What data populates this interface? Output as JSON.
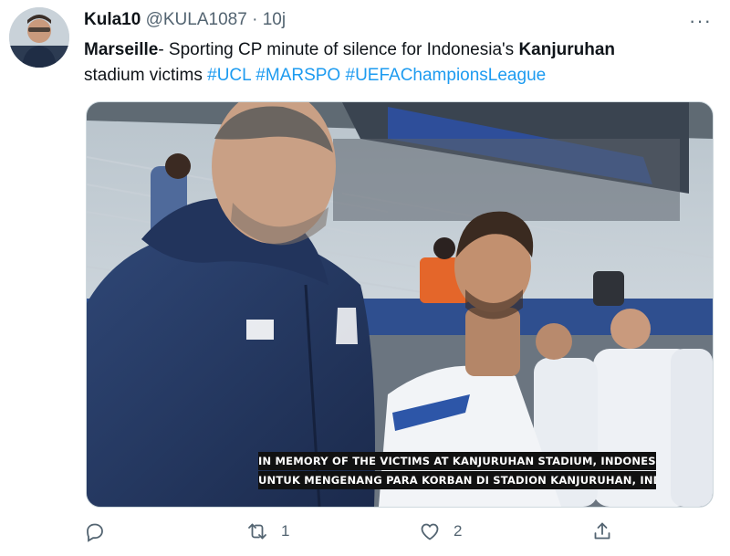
{
  "tweet": {
    "author_name": "Kula10",
    "author_handle": "@KULA1087",
    "separator": "·",
    "time": "10j",
    "more_label": "···",
    "text_bold_1": "Marseille",
    "text_1": "- Sporting CP minute of silence for  Indonesia's ",
    "text_bold_2": "Kanjuruhan",
    "text_2": "stadium victims ",
    "hashtags": [
      "#UCL",
      "#MARSPO",
      "#UEFAChampionsLeague"
    ]
  },
  "media": {
    "caption_line_1": "IN MEMORY OF THE VICTIMS AT KANJURUHAN STADIUM, INDONESIA",
    "caption_line_2": "UNTUK MENGENANG PARA KORBAN DI STADION KANJURUHAN, INDONESIA"
  },
  "actions": {
    "reply_count": "",
    "retweet_count": "1",
    "like_count": "2",
    "share_count": ""
  },
  "icons": [
    "reply-icon",
    "retweet-icon",
    "like-icon",
    "share-icon",
    "more-icon"
  ],
  "colors": {
    "link": "#1d9bf0",
    "muted": "#536471",
    "text": "#0f1419"
  }
}
